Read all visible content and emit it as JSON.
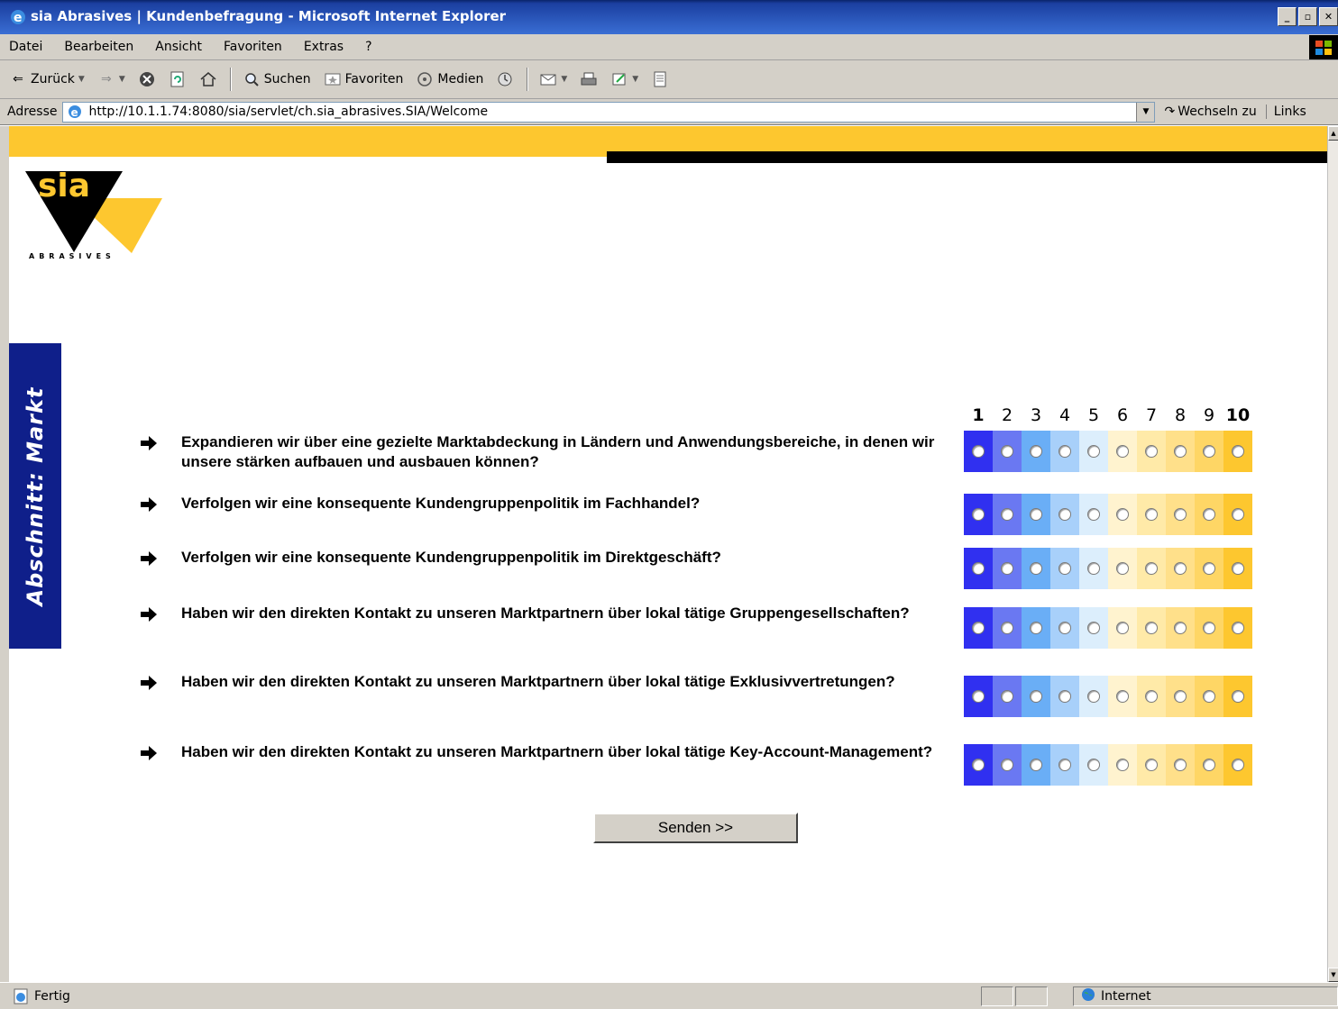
{
  "window": {
    "title": "sia Abrasives | Kundenbefragung - Microsoft Internet Explorer",
    "controls": [
      "_",
      "▫",
      "✕"
    ]
  },
  "menu": {
    "items": [
      "Datei",
      "Bearbeiten",
      "Ansicht",
      "Favoriten",
      "Extras",
      "?"
    ]
  },
  "toolbar": {
    "back_label": "Zurück",
    "search_label": "Suchen",
    "favorites_label": "Favoriten",
    "media_label": "Medien"
  },
  "address": {
    "label": "Adresse",
    "url": "http://10.1.1.74:8080/sia/servlet/ch.sia_abrasives.SIA/Welcome",
    "go_label": "Wechseln zu",
    "links_label": "Links"
  },
  "page": {
    "logo_text": "sia",
    "logo_subtext": "ABRASIVES",
    "section_label": "Abschnitt: Markt",
    "scale": [
      "1",
      "2",
      "3",
      "4",
      "5",
      "6",
      "7",
      "8",
      "9",
      "10"
    ],
    "rating_colors": [
      "#3030f0",
      "#6a78f2",
      "#6aaef6",
      "#a8d0fa",
      "#dceefc",
      "#fff3cf",
      "#ffeaa8",
      "#ffe08a",
      "#fed665",
      "#fdc72f"
    ],
    "questions": [
      {
        "text": "Expandieren wir über eine gezielte Marktabdeckung in Ländern und Anwendungsbereiche, in denen wir unsere stärken aufbauen und ausbauen können?"
      },
      {
        "text": "Verfolgen wir eine konsequente Kundengruppenpolitik im Fachhandel?"
      },
      {
        "text": "Verfolgen wir eine konsequente Kundengruppenpolitik im Direktgeschäft?"
      },
      {
        "text": "Haben wir den direkten Kontakt zu unseren Marktpartnern über lokal tätige Gruppengesellschaften?"
      },
      {
        "text": "Haben wir den direkten Kontakt zu unseren Marktpartnern über lokal tätige Exklusivvertretungen?"
      },
      {
        "text": "Haben wir den direkten Kontakt zu unseren Marktpartnern über lokal tätige Key-Account-Management?"
      }
    ],
    "submit_label": "Senden >>"
  },
  "status": {
    "text": "Fertig",
    "zone": "Internet"
  }
}
